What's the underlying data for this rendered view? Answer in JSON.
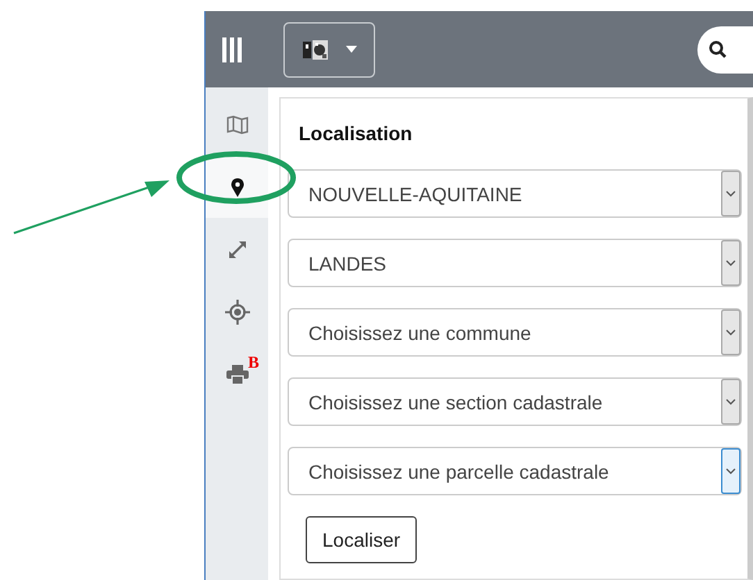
{
  "sidebar": {
    "items": [
      {
        "kind": "map",
        "selected": false
      },
      {
        "kind": "pin",
        "selected": true
      },
      {
        "kind": "expand",
        "selected": false
      },
      {
        "kind": "target",
        "selected": false
      },
      {
        "kind": "print",
        "selected": false,
        "badge": "B"
      }
    ]
  },
  "panel": {
    "title": "Localisation",
    "selects": [
      {
        "value": "NOUVELLE-AQUITAINE",
        "focused": false
      },
      {
        "value": "LANDES",
        "focused": false
      },
      {
        "value": "Choisissez une commune",
        "focused": false
      },
      {
        "value": "Choisissez une section cadastrale",
        "focused": false
      },
      {
        "value": "Choisissez une parcelle cadastrale",
        "focused": true
      }
    ],
    "button": "Localiser"
  },
  "annotation": {
    "kind": "arrow"
  }
}
